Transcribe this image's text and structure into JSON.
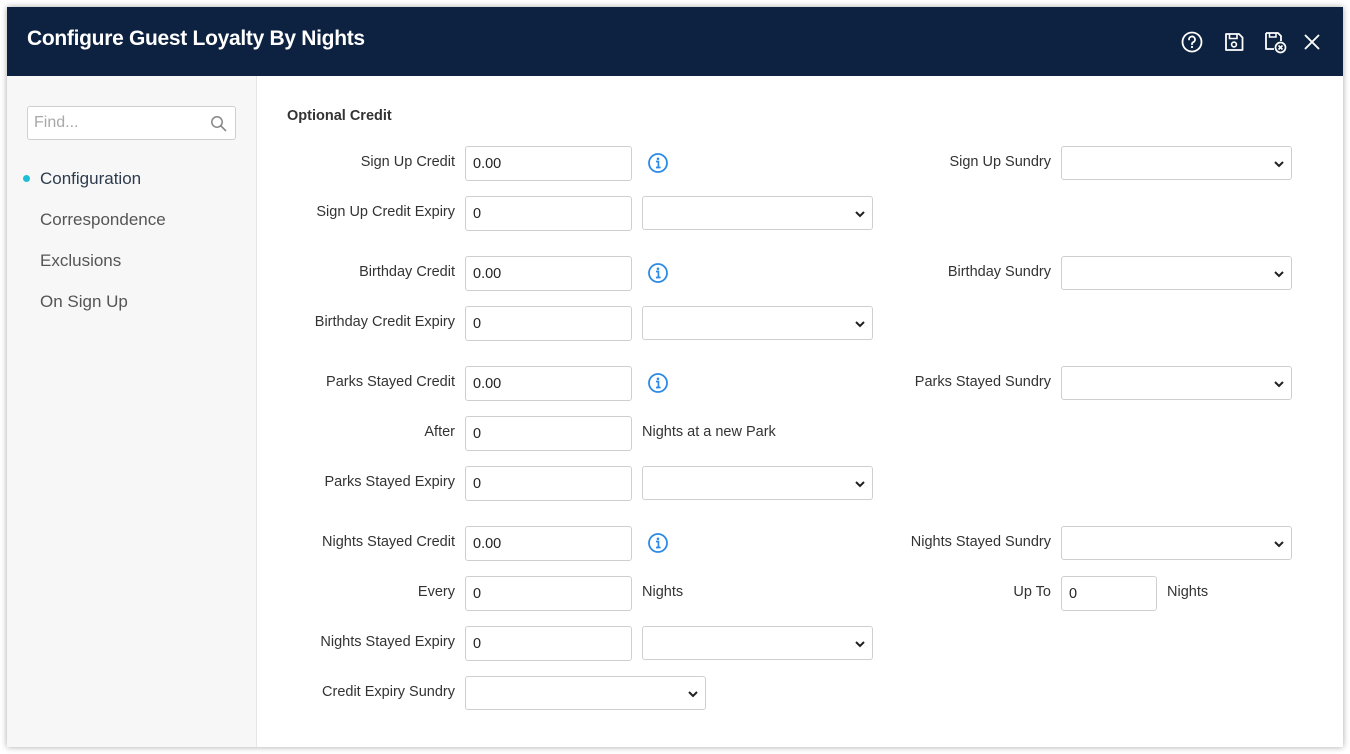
{
  "window": {
    "title": "Configure Guest Loyalty By Nights",
    "toolbar_icons": [
      "help-icon",
      "save-icon",
      "save-close-icon",
      "close-icon"
    ]
  },
  "sidebar": {
    "search_placeholder": "Find...",
    "items": [
      {
        "label": "Configuration",
        "active": true
      },
      {
        "label": "Correspondence",
        "active": false
      },
      {
        "label": "Exclusions",
        "active": false
      },
      {
        "label": "On Sign Up",
        "active": false
      }
    ]
  },
  "form": {
    "section_title": "Optional Credit",
    "sign_up_credit": {
      "label": "Sign Up Credit",
      "value": "0.00"
    },
    "sign_up_sundry": {
      "label": "Sign Up Sundry",
      "value": ""
    },
    "sign_up_credit_expiry": {
      "label": "Sign Up Credit Expiry",
      "value": "0",
      "unit": ""
    },
    "birthday_credit": {
      "label": "Birthday Credit",
      "value": "0.00"
    },
    "birthday_sundry": {
      "label": "Birthday Sundry",
      "value": ""
    },
    "birthday_credit_expiry": {
      "label": "Birthday Credit Expiry",
      "value": "0",
      "unit": ""
    },
    "parks_stayed_credit": {
      "label": "Parks Stayed Credit",
      "value": "0.00"
    },
    "parks_stayed_sundry": {
      "label": "Parks Stayed Sundry",
      "value": ""
    },
    "after": {
      "label": "After",
      "value": "0",
      "suffix": "Nights at a new Park"
    },
    "parks_stayed_expiry": {
      "label": "Parks Stayed Expiry",
      "value": "0",
      "unit": ""
    },
    "nights_stayed_credit": {
      "label": "Nights Stayed Credit",
      "value": "0.00"
    },
    "nights_stayed_sundry": {
      "label": "Nights Stayed Sundry",
      "value": ""
    },
    "every": {
      "label": "Every",
      "value": "0",
      "suffix": "Nights"
    },
    "up_to": {
      "label": "Up To",
      "value": "0",
      "suffix": "Nights"
    },
    "nights_stayed_expiry": {
      "label": "Nights Stayed Expiry",
      "value": "0",
      "unit": ""
    },
    "credit_expiry_sundry": {
      "label": "Credit Expiry Sundry",
      "value": ""
    }
  },
  "colors": {
    "titlebar": "#0d2240",
    "accent_dot": "#1cbfd6",
    "info_icon": "#2b8ae6"
  }
}
